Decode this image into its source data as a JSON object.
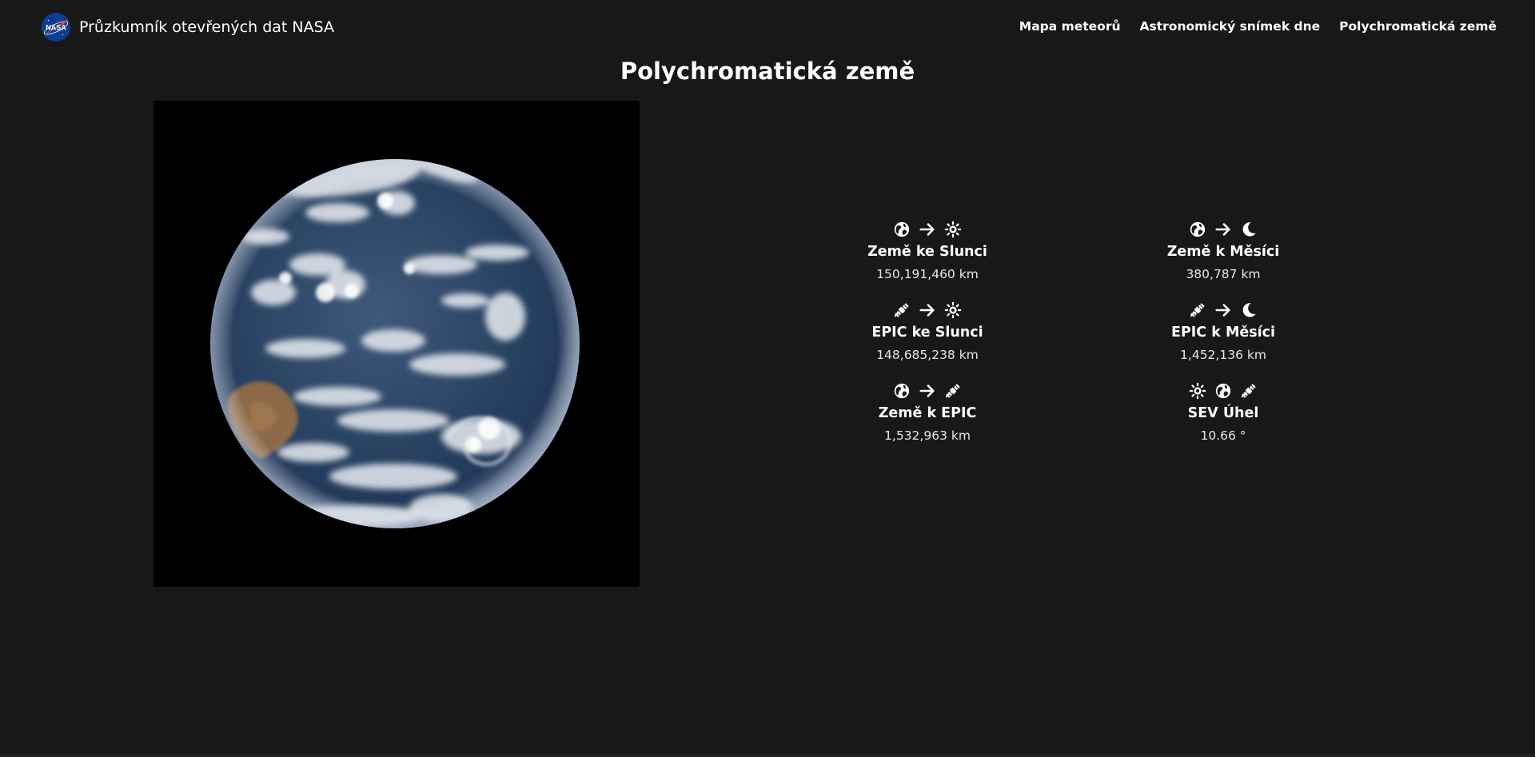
{
  "navbar": {
    "brand_title": "Průzkumník otevřených dat NASA",
    "logo_text": "NASA",
    "links": [
      {
        "label": "Mapa meteorů"
      },
      {
        "label": "Astronomický snímek dne"
      },
      {
        "label": "Polychromatická země"
      }
    ]
  },
  "page": {
    "title": "Polychromatická země"
  },
  "stats": [
    {
      "icons": [
        "earth-icon",
        "arrow-right-icon",
        "sun-icon"
      ],
      "label": "Země ke Slunci",
      "value": "150,191,460 km"
    },
    {
      "icons": [
        "earth-icon",
        "arrow-right-icon",
        "moon-icon"
      ],
      "label": "Země k Měsíci",
      "value": "380,787 km"
    },
    {
      "icons": [
        "satellite-icon",
        "arrow-right-icon",
        "sun-icon"
      ],
      "label": "EPIC ke Slunci",
      "value": "148,685,238 km"
    },
    {
      "icons": [
        "satellite-icon",
        "arrow-right-icon",
        "moon-icon"
      ],
      "label": "EPIC k Měsíci",
      "value": "1,452,136 km"
    },
    {
      "icons": [
        "earth-icon",
        "arrow-right-icon",
        "satellite-icon"
      ],
      "label": "Země k EPIC",
      "value": "1,532,963 km"
    },
    {
      "icons": [
        "sun-icon",
        "earth-icon",
        "satellite-icon"
      ],
      "label": "SEV Úhel",
      "value": "10.66 °"
    }
  ],
  "colors": {
    "background": "#181818",
    "text": "#ffffff",
    "nasa_blue": "#0b3d91",
    "nasa_red": "#fc3d21"
  }
}
